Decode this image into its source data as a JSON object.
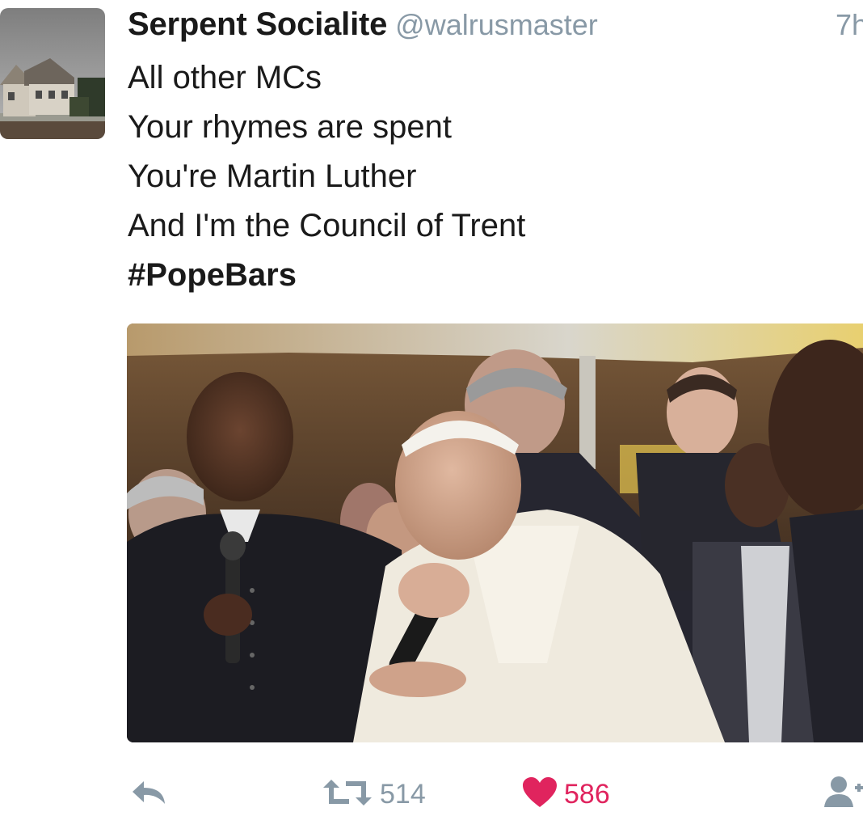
{
  "tweet": {
    "display_name": "Serpent Socialite",
    "handle": "@walrusmaster",
    "timestamp": "7h",
    "lines": [
      "All other MCs",
      "Your rhymes are spent",
      "You're Martin Luther",
      "And I'm the Council of Trent"
    ],
    "hashtag": "#PopeBars"
  },
  "actions": {
    "reply_icon": "reply-arrow-icon",
    "retweet_icon": "retweet-icon",
    "retweet_count": "514",
    "like_icon": "heart-icon",
    "like_count": "586",
    "follow_icon": "follow-user-icon"
  },
  "colors": {
    "text": "#1a1a1a",
    "muted": "#8899a6",
    "like": "#e0245e"
  }
}
